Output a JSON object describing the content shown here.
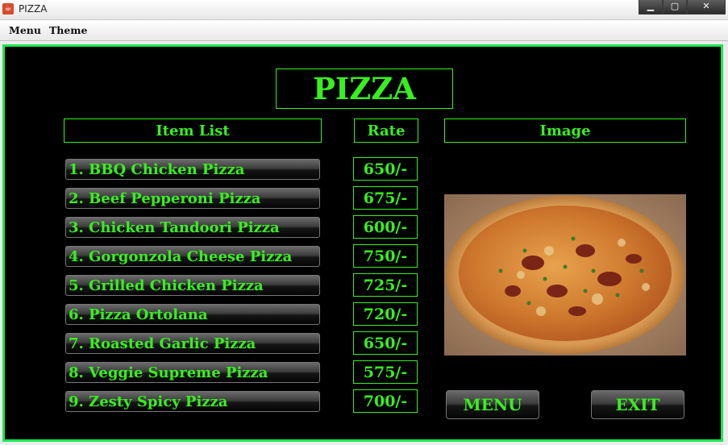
{
  "window": {
    "title": "PIZZA",
    "app_icon": "java-cup-icon"
  },
  "menubar": {
    "items": [
      "Menu",
      "Theme"
    ]
  },
  "main": {
    "heading": "PIZZA",
    "headers": {
      "items": "Item List",
      "rate": "Rate",
      "image": "Image"
    },
    "items": [
      {
        "label": "1. BBQ Chicken Pizza",
        "rate": "650/-"
      },
      {
        "label": "2. Beef Pepperoni Pizza",
        "rate": "675/-"
      },
      {
        "label": "3. Chicken Tandoori Pizza",
        "rate": "600/-"
      },
      {
        "label": "4. Gorgonzola Cheese Pizza",
        "rate": "750/-"
      },
      {
        "label": "5. Grilled Chicken Pizza",
        "rate": "725/-"
      },
      {
        "label": "6. Pizza Ortolana",
        "rate": "720/-"
      },
      {
        "label": "7. Roasted Garlic Pizza",
        "rate": "650/-"
      },
      {
        "label": "8. Veggie Supreme Pizza",
        "rate": "575/-"
      },
      {
        "label": "9. Zesty Spicy Pizza",
        "rate": "700/-"
      }
    ],
    "buttons": {
      "menu": "MENU",
      "exit": "EXIT"
    }
  },
  "colors": {
    "accent": "#37f01e",
    "border": "#18e94f",
    "background": "#000000"
  }
}
